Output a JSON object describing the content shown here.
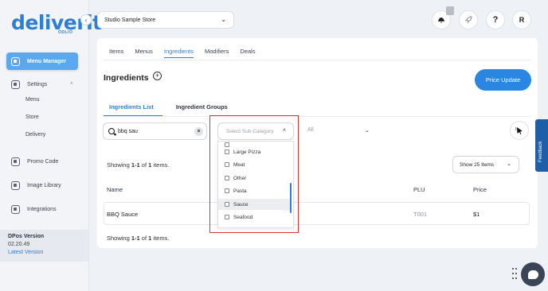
{
  "sidebar": {
    "logo": "deliverit",
    "logo_sub": "ODLIO",
    "collapse": "‹",
    "menu_manager": "Menu Manager",
    "settings": "Settings",
    "settings_caret": "˄",
    "sub_items": [
      "Menu",
      "Store",
      "Delivery"
    ],
    "promo_code": "Promo Code",
    "image_library": "Image Library",
    "integrations": "Integrations",
    "version_title": "DPos Version",
    "version_number": "02.20.49",
    "latest_version": "Latest Version"
  },
  "header": {
    "store_name": "Studio Sample Store",
    "chevron": "⌄",
    "help": "?",
    "user_initial": "R"
  },
  "tabs": [
    "Items",
    "Menus",
    "Ingredients",
    "Modifiers",
    "Deals"
  ],
  "page": {
    "title": "Ingredients",
    "add": "+",
    "price_update": "Price Update"
  },
  "subtabs": {
    "list": "Ingredients List",
    "groups": "Ingredient Groups"
  },
  "filters": {
    "search_value": "bbq sau",
    "clear": "×",
    "sub_category_placeholder": "Select Sub Category",
    "sub_chevron": "˄",
    "all": "All",
    "all_chevron": "⌄"
  },
  "dropdown": {
    "options": [
      "Large Pizza",
      "Meat",
      "Other",
      "Pasta",
      "Sauce",
      "Seafood"
    ],
    "selected_index": 4
  },
  "list": {
    "showing_prefix": "Showing ",
    "showing_range": "1-1",
    "showing_of": " of ",
    "showing_total": "1",
    "showing_suffix": " items.",
    "page_size": "Show 25 Items",
    "columns": {
      "name": "Name",
      "plu": "PLU",
      "price": "Price"
    },
    "rows": [
      {
        "name": "BBQ Sauce",
        "plu": "T001",
        "price": "$1"
      }
    ]
  },
  "feedback": "Feedback",
  "colors": {
    "accent": "#2b7fd4",
    "highlight": "#e0302a",
    "button": "#2a86e0"
  }
}
